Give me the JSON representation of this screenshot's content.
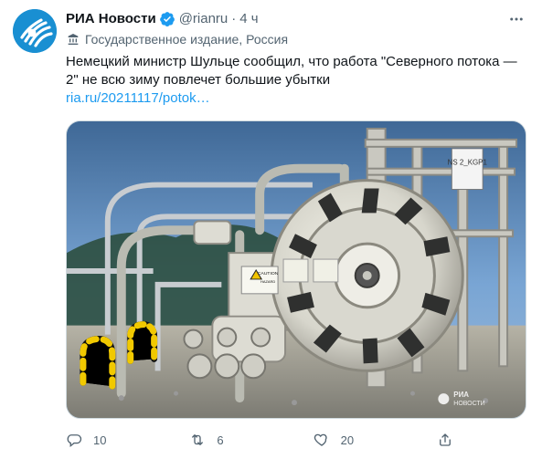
{
  "author": {
    "name": "РИА Новости",
    "handle": "@rianru",
    "separator": "·",
    "time": "4 ч",
    "label": "Государственное издание, Россия"
  },
  "tweet": {
    "text": "Немецкий министр Шульце сообщил, что работа \"Северного потока — 2\" не всю зиму повлечет большие убытки",
    "link_text": "ria.ru/20211117/potok…"
  },
  "media": {
    "caution_title": "CAUTION",
    "caution_sub": "HAZARD",
    "sign_top": "NS 2_KGP1",
    "watermark_top": "РИА",
    "watermark_bottom": "НОВОСТИ"
  },
  "actions": {
    "reply_count": "10",
    "retweet_count": "6",
    "like_count": "20"
  },
  "icons": {
    "verified": "verified-badge-icon",
    "state_media": "state-media-icon",
    "more": "more-options-icon",
    "reply": "reply-icon",
    "retweet": "retweet-icon",
    "like": "heart-icon",
    "share": "share-icon"
  },
  "colors": {
    "accent": "#1d9bf0",
    "text": "#0f1419",
    "secondary": "#536471",
    "avatar": "#1a8ed1"
  }
}
